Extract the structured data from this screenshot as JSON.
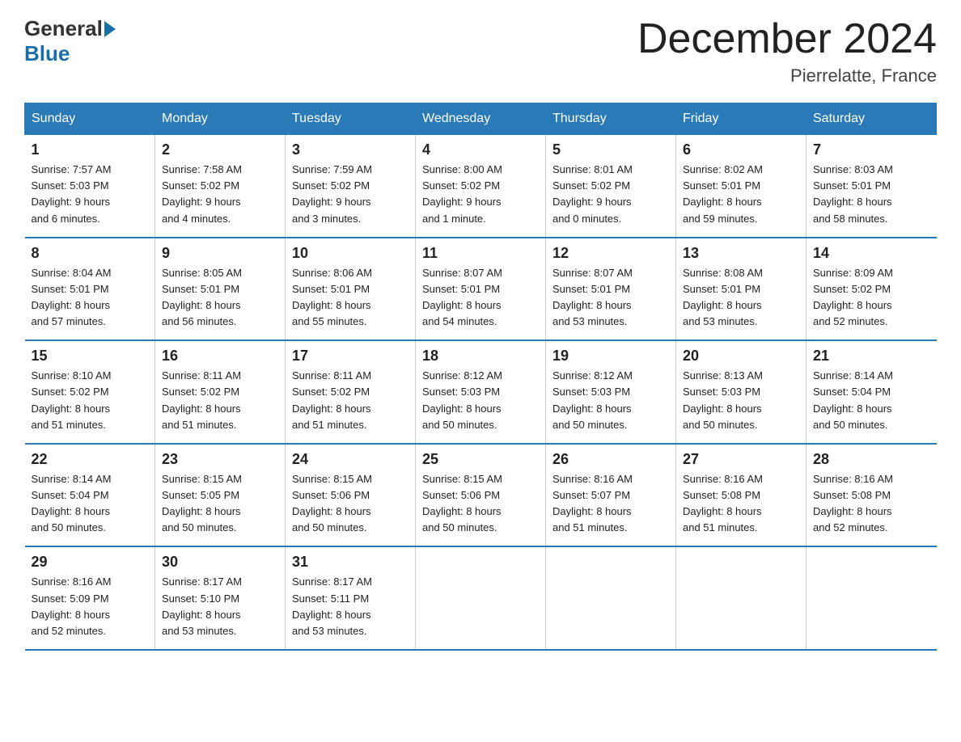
{
  "logo": {
    "general": "General",
    "blue": "Blue"
  },
  "title": "December 2024",
  "location": "Pierrelatte, France",
  "days_of_week": [
    "Sunday",
    "Monday",
    "Tuesday",
    "Wednesday",
    "Thursday",
    "Friday",
    "Saturday"
  ],
  "weeks": [
    [
      {
        "day": "1",
        "info": "Sunrise: 7:57 AM\nSunset: 5:03 PM\nDaylight: 9 hours\nand 6 minutes."
      },
      {
        "day": "2",
        "info": "Sunrise: 7:58 AM\nSunset: 5:02 PM\nDaylight: 9 hours\nand 4 minutes."
      },
      {
        "day": "3",
        "info": "Sunrise: 7:59 AM\nSunset: 5:02 PM\nDaylight: 9 hours\nand 3 minutes."
      },
      {
        "day": "4",
        "info": "Sunrise: 8:00 AM\nSunset: 5:02 PM\nDaylight: 9 hours\nand 1 minute."
      },
      {
        "day": "5",
        "info": "Sunrise: 8:01 AM\nSunset: 5:02 PM\nDaylight: 9 hours\nand 0 minutes."
      },
      {
        "day": "6",
        "info": "Sunrise: 8:02 AM\nSunset: 5:01 PM\nDaylight: 8 hours\nand 59 minutes."
      },
      {
        "day": "7",
        "info": "Sunrise: 8:03 AM\nSunset: 5:01 PM\nDaylight: 8 hours\nand 58 minutes."
      }
    ],
    [
      {
        "day": "8",
        "info": "Sunrise: 8:04 AM\nSunset: 5:01 PM\nDaylight: 8 hours\nand 57 minutes."
      },
      {
        "day": "9",
        "info": "Sunrise: 8:05 AM\nSunset: 5:01 PM\nDaylight: 8 hours\nand 56 minutes."
      },
      {
        "day": "10",
        "info": "Sunrise: 8:06 AM\nSunset: 5:01 PM\nDaylight: 8 hours\nand 55 minutes."
      },
      {
        "day": "11",
        "info": "Sunrise: 8:07 AM\nSunset: 5:01 PM\nDaylight: 8 hours\nand 54 minutes."
      },
      {
        "day": "12",
        "info": "Sunrise: 8:07 AM\nSunset: 5:01 PM\nDaylight: 8 hours\nand 53 minutes."
      },
      {
        "day": "13",
        "info": "Sunrise: 8:08 AM\nSunset: 5:01 PM\nDaylight: 8 hours\nand 53 minutes."
      },
      {
        "day": "14",
        "info": "Sunrise: 8:09 AM\nSunset: 5:02 PM\nDaylight: 8 hours\nand 52 minutes."
      }
    ],
    [
      {
        "day": "15",
        "info": "Sunrise: 8:10 AM\nSunset: 5:02 PM\nDaylight: 8 hours\nand 51 minutes."
      },
      {
        "day": "16",
        "info": "Sunrise: 8:11 AM\nSunset: 5:02 PM\nDaylight: 8 hours\nand 51 minutes."
      },
      {
        "day": "17",
        "info": "Sunrise: 8:11 AM\nSunset: 5:02 PM\nDaylight: 8 hours\nand 51 minutes."
      },
      {
        "day": "18",
        "info": "Sunrise: 8:12 AM\nSunset: 5:03 PM\nDaylight: 8 hours\nand 50 minutes."
      },
      {
        "day": "19",
        "info": "Sunrise: 8:12 AM\nSunset: 5:03 PM\nDaylight: 8 hours\nand 50 minutes."
      },
      {
        "day": "20",
        "info": "Sunrise: 8:13 AM\nSunset: 5:03 PM\nDaylight: 8 hours\nand 50 minutes."
      },
      {
        "day": "21",
        "info": "Sunrise: 8:14 AM\nSunset: 5:04 PM\nDaylight: 8 hours\nand 50 minutes."
      }
    ],
    [
      {
        "day": "22",
        "info": "Sunrise: 8:14 AM\nSunset: 5:04 PM\nDaylight: 8 hours\nand 50 minutes."
      },
      {
        "day": "23",
        "info": "Sunrise: 8:15 AM\nSunset: 5:05 PM\nDaylight: 8 hours\nand 50 minutes."
      },
      {
        "day": "24",
        "info": "Sunrise: 8:15 AM\nSunset: 5:06 PM\nDaylight: 8 hours\nand 50 minutes."
      },
      {
        "day": "25",
        "info": "Sunrise: 8:15 AM\nSunset: 5:06 PM\nDaylight: 8 hours\nand 50 minutes."
      },
      {
        "day": "26",
        "info": "Sunrise: 8:16 AM\nSunset: 5:07 PM\nDaylight: 8 hours\nand 51 minutes."
      },
      {
        "day": "27",
        "info": "Sunrise: 8:16 AM\nSunset: 5:08 PM\nDaylight: 8 hours\nand 51 minutes."
      },
      {
        "day": "28",
        "info": "Sunrise: 8:16 AM\nSunset: 5:08 PM\nDaylight: 8 hours\nand 52 minutes."
      }
    ],
    [
      {
        "day": "29",
        "info": "Sunrise: 8:16 AM\nSunset: 5:09 PM\nDaylight: 8 hours\nand 52 minutes."
      },
      {
        "day": "30",
        "info": "Sunrise: 8:17 AM\nSunset: 5:10 PM\nDaylight: 8 hours\nand 53 minutes."
      },
      {
        "day": "31",
        "info": "Sunrise: 8:17 AM\nSunset: 5:11 PM\nDaylight: 8 hours\nand 53 minutes."
      },
      {
        "day": "",
        "info": ""
      },
      {
        "day": "",
        "info": ""
      },
      {
        "day": "",
        "info": ""
      },
      {
        "day": "",
        "info": ""
      }
    ]
  ]
}
